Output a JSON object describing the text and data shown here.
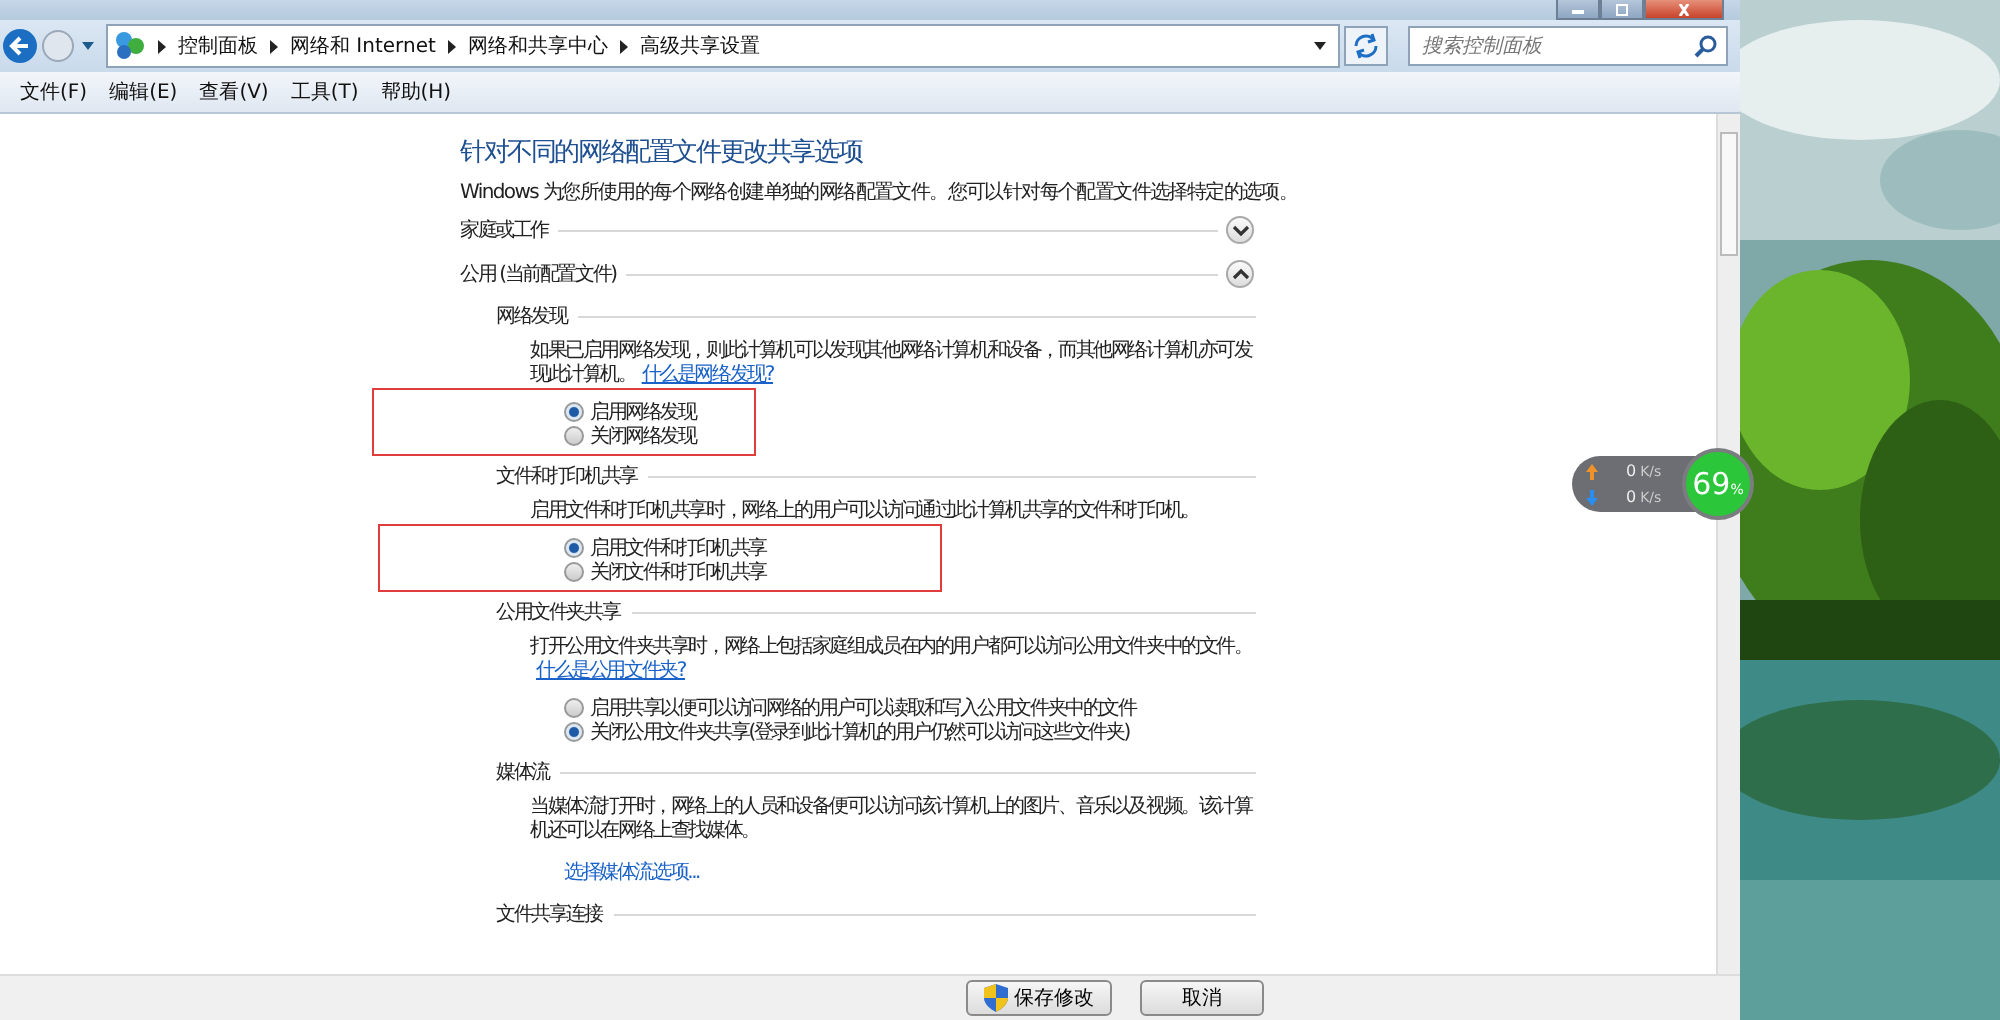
{
  "address_bar": {
    "breadcrumbs": [
      "控制面板",
      "网络和 Internet",
      "网络和共享中心",
      "高级共享设置"
    ]
  },
  "search": {
    "placeholder": "搜索控制面板"
  },
  "menu": [
    "文件(F)",
    "编辑(E)",
    "查看(V)",
    "工具(T)",
    "帮助(H)"
  ],
  "page": {
    "title": "针对不同的网络配置文件更改共享选项",
    "intro": "Windows 为您所使用的每个网络创建单独的网络配置文件。您可以针对每个配置文件选择特定的选项。",
    "profiles": [
      {
        "label": "家庭或工作",
        "expanded": false
      },
      {
        "label": "公用 (当前配置文件)",
        "expanded": true,
        "sections": [
          {
            "heading": "网络发现",
            "description": "如果已启用网络发现，则此计算机可以发现其他网络计算机和设备，而其他网络计算机亦可发现此计算机。",
            "link": "什么是网络发现?",
            "highlighted": true,
            "options": [
              {
                "label": "启用网络发现",
                "selected": true
              },
              {
                "label": "关闭网络发现",
                "selected": false
              }
            ]
          },
          {
            "heading": "文件和打印机共享",
            "description": "启用文件和打印机共享时，网络上的用户可以访问通过此计算机共享的文件和打印机。",
            "highlighted": true,
            "options": [
              {
                "label": "启用文件和打印机共享",
                "selected": true
              },
              {
                "label": "关闭文件和打印机共享",
                "selected": false
              }
            ]
          },
          {
            "heading": "公用文件夹共享",
            "description": "打开公用文件夹共享时，网络上包括家庭组成员在内的用户都可以访问公用文件夹中的文件。",
            "link": "什么是公用文件夹?",
            "options": [
              {
                "label": "启用共享以便可以访问网络的用户可以读取和写入公用文件夹中的文件",
                "selected": false
              },
              {
                "label": "关闭公用文件夹共享(登录到此计算机的用户仍然可以访问这些文件夹)",
                "selected": true
              }
            ]
          },
          {
            "heading": "媒体流",
            "description": "当媒体流打开时，网络上的人员和设备便可以访问该计算机上的图片、音乐以及视频。该计算机还可以在网络上查找媒体。",
            "action_link": "选择媒体流选项..."
          },
          {
            "heading": "文件共享连接"
          }
        ]
      }
    ]
  },
  "footer": {
    "buttons": [
      {
        "label": "保存修改",
        "kind": "admin"
      },
      {
        "label": "取消",
        "kind": "plain"
      }
    ]
  },
  "network_widget": {
    "rows": [
      {
        "kind": "upload",
        "value": "0",
        "unit": "K/s"
      },
      {
        "kind": "download",
        "value": "0",
        "unit": "K/s"
      }
    ],
    "usage": "69",
    "usage_unit": "%"
  }
}
